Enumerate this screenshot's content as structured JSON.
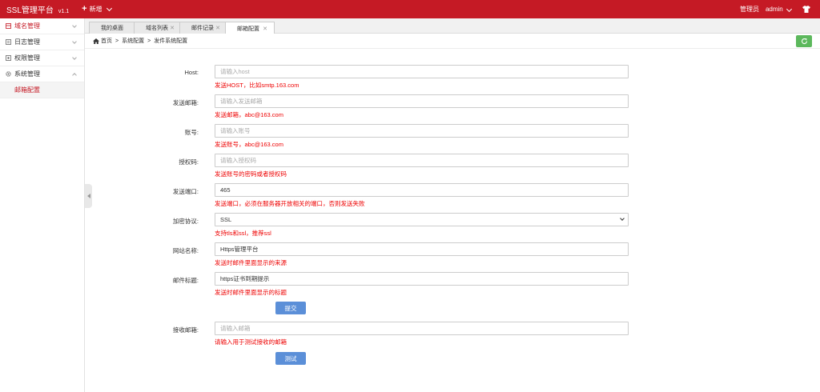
{
  "topbar": {
    "brand": "SSL管理平台",
    "version": "v1.1",
    "new_label": "新增",
    "role": "管理员",
    "user": "admin"
  },
  "sidebar": {
    "items": [
      {
        "label": "域名管理",
        "icon": "domain-icon",
        "active": true
      },
      {
        "label": "日志管理",
        "icon": "log-icon",
        "active": false
      },
      {
        "label": "权限管理",
        "icon": "permission-icon",
        "active": false
      },
      {
        "label": "系统管理",
        "icon": "gear-icon",
        "active": false,
        "expanded": true
      }
    ],
    "sub_items": [
      {
        "label": "邮箱配置"
      }
    ]
  },
  "tabs": [
    {
      "label": "我的桌面",
      "closable": false,
      "active": false
    },
    {
      "label": "域名列表",
      "closable": true,
      "active": false
    },
    {
      "label": "邮件记录",
      "closable": true,
      "active": false
    },
    {
      "label": "邮箱配置",
      "closable": true,
      "active": true
    }
  ],
  "breadcrumb": {
    "home": "首页",
    "level1": "系统配置",
    "level2": "发件系统配置",
    "separator": ">"
  },
  "form": {
    "host": {
      "label": "Host:",
      "value": "",
      "placeholder": "请输入host",
      "hint": "发送HOST，比如smtp.163.com"
    },
    "from": {
      "label": "发送邮箱:",
      "value": "",
      "placeholder": "请输入发送邮箱",
      "hint": "发送邮箱，abc@163.com"
    },
    "account": {
      "label": "账号:",
      "value": "",
      "placeholder": "请输入账号",
      "hint": "发送账号，abc@163.com"
    },
    "authcode": {
      "label": "授权码:",
      "value": "",
      "placeholder": "请输入授权码",
      "hint": "发送账号的密码或者授权码"
    },
    "port": {
      "label": "发送端口:",
      "value": "465",
      "placeholder": "",
      "hint": "发送端口，必须在服务器开放相关的端口，否则发送失败"
    },
    "encryption": {
      "label": "加密协议:",
      "value": "SSL",
      "hint": "支持tls和ssl，推荐ssl"
    },
    "sitename": {
      "label": "网站名称:",
      "value": "Https管理平台",
      "placeholder": "",
      "hint": "发送时邮件里面显示的来源"
    },
    "subject": {
      "label": "邮件标题:",
      "value": "https证书到期提示",
      "placeholder": "",
      "hint": "发送时邮件里面显示的标题"
    },
    "submit_label": "提交",
    "receiver": {
      "label": "接收邮箱:",
      "value": "",
      "placeholder": "请输入邮箱",
      "hint": "请输入用于测试接收的邮箱"
    },
    "test_label": "测试"
  },
  "colors": {
    "brand_red": "#c51a25",
    "button_blue": "#5b8fd8",
    "refresh_green": "#5cb85c",
    "hint_red": "#e00000"
  }
}
